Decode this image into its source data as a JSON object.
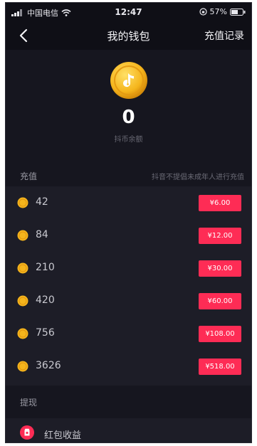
{
  "status_bar": {
    "carrier": "中国电信",
    "time": "12:47",
    "battery": "57%"
  },
  "nav": {
    "title": "我的钱包",
    "right_action": "充值记录"
  },
  "balance": {
    "value": "0",
    "label": "抖币余额"
  },
  "recharge": {
    "title": "充值",
    "note": "抖音不提倡未成年人进行充值",
    "options": [
      {
        "coins": "42",
        "price": "¥6.00"
      },
      {
        "coins": "84",
        "price": "¥12.00"
      },
      {
        "coins": "210",
        "price": "¥30.00"
      },
      {
        "coins": "420",
        "price": "¥60.00"
      },
      {
        "coins": "756",
        "price": "¥108.00"
      },
      {
        "coins": "3626",
        "price": "¥518.00"
      }
    ]
  },
  "withdraw": {
    "title": "提现",
    "item_label": "红包收益"
  },
  "colors": {
    "accent": "#fe2c55",
    "coin_gold": "#f5b51c",
    "background": "#16161f",
    "row_background": "#1d1d27"
  }
}
